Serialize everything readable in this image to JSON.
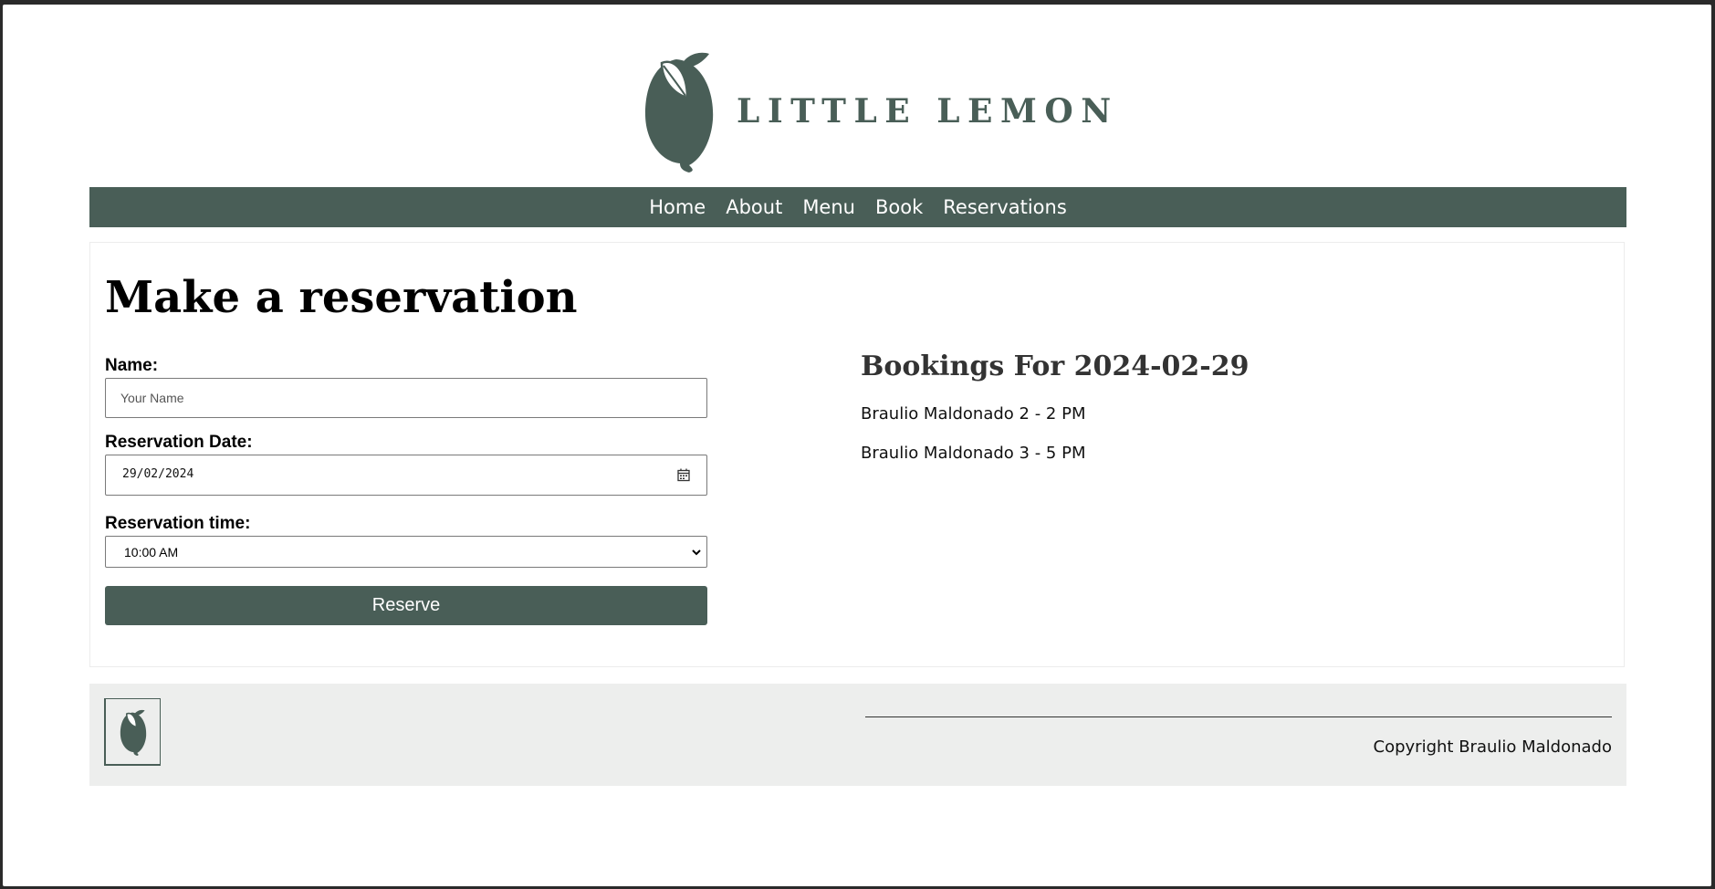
{
  "header": {
    "brand_name": "LITTLE LEMON",
    "logo_icon": "lemon-icon"
  },
  "nav": {
    "items": [
      {
        "label": "Home"
      },
      {
        "label": "About"
      },
      {
        "label": "Menu"
      },
      {
        "label": "Book"
      },
      {
        "label": "Reservations"
      }
    ]
  },
  "main": {
    "title": "Make a reservation",
    "form": {
      "name_label": "Name:",
      "name_placeholder": "Your Name",
      "name_value": "",
      "date_label": "Reservation Date:",
      "date_value": "29/02/2024",
      "date_icon": "calendar-icon",
      "time_label": "Reservation time:",
      "time_value": "10:00 AM",
      "time_icon": "chevron-down-icon",
      "submit_label": "Reserve"
    },
    "bookings": {
      "title": "Bookings For 2024-02-29",
      "items": [
        {
          "text": "Braulio Maldonado 2 - 2 PM"
        },
        {
          "text": "Braulio Maldonado 3 - 5 PM"
        }
      ]
    }
  },
  "footer": {
    "logo_icon": "lemon-icon",
    "copyright": "Copyright Braulio Maldonado"
  },
  "colors": {
    "primary": "#495e57",
    "footer_bg": "#edeeed",
    "heading": "#333333"
  }
}
